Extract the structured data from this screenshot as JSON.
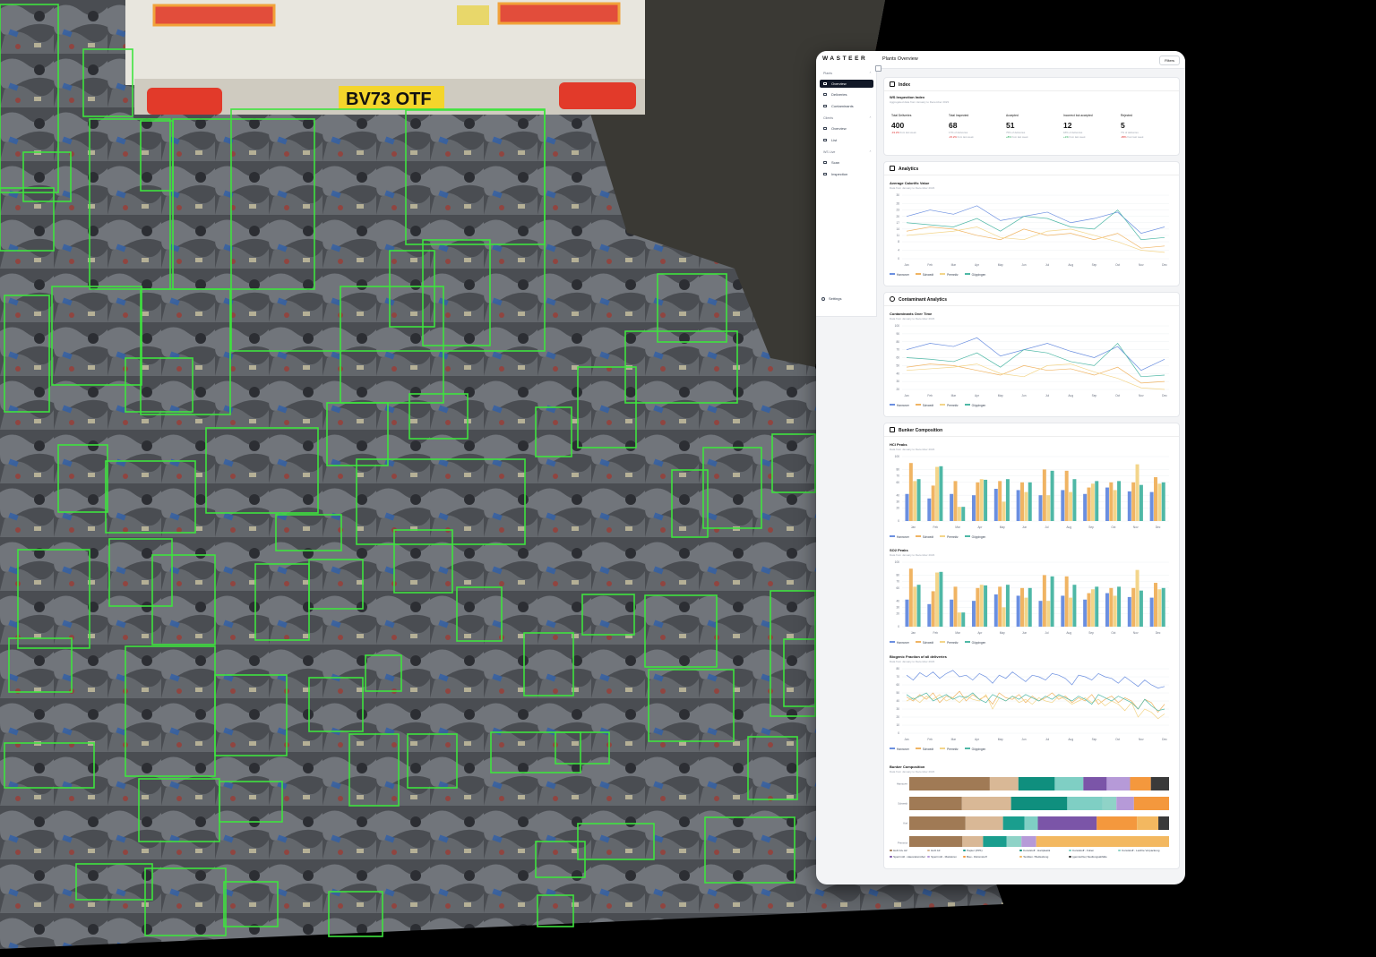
{
  "app": {
    "logo": "WASTEER",
    "page_title": "Plants Overview",
    "filters_label": "Filters"
  },
  "colors": {
    "blue": "#6b8fe0",
    "orange": "#f0b463",
    "yellow": "#f3d58a",
    "teal": "#4fb8a6",
    "detection_box": "#3fe33f"
  },
  "sidebar": {
    "groups": [
      {
        "label": "Plants",
        "items": [
          {
            "label": "Overview",
            "active": true,
            "icon": "grid-icon"
          },
          {
            "label": "Deliveries",
            "icon": "truck-icon"
          },
          {
            "label": "Contaminants",
            "icon": "biohazard-icon"
          }
        ]
      },
      {
        "label": "Clients",
        "items": [
          {
            "label": "Overview",
            "icon": "grid-icon"
          },
          {
            "label": "List",
            "icon": "list-icon"
          }
        ]
      },
      {
        "label": "WS Live",
        "items": [
          {
            "label": "Scan",
            "icon": "scan-icon"
          },
          {
            "label": "Inspection",
            "icon": "eye-icon"
          }
        ]
      }
    ],
    "settings_label": "Settings"
  },
  "index": {
    "title": "Index",
    "subtitle": "WS Inspection Index",
    "description": "Aggregated data from January to December 2023",
    "kpis": [
      {
        "label": "Total Deliveries",
        "value": "400",
        "sub": "",
        "change": "-19.2%",
        "direction": "down",
        "note": "from last week"
      },
      {
        "label": "Total Inspected",
        "value": "68",
        "sub": "17% of deliveries",
        "change": "-15.2%",
        "direction": "down",
        "note": "from last week"
      },
      {
        "label": "Accepted",
        "value": "51",
        "sub": "75% of deliveries",
        "change": "+8%",
        "direction": "up",
        "note": "from last week"
      },
      {
        "label": "Incorrect but accepted",
        "value": "12",
        "sub": "18% of deliveries",
        "change": "+1%",
        "direction": "up",
        "note": "from last week"
      },
      {
        "label": "Rejected",
        "value": "5",
        "sub": "7% of deliveries",
        "change": "-95%",
        "direction": "down",
        "note": "from last week"
      }
    ]
  },
  "analytics": {
    "title": "Analytics",
    "chart_title": "Average Calorific Value",
    "chart_desc": "Data from January to December 2023"
  },
  "contaminant_analytics": {
    "title": "Contaminant Analytics",
    "chart_title": "Contaminants Over Time",
    "chart_desc": "Data from January to December 2023"
  },
  "bunker": {
    "title": "Bunker Composition",
    "hcl_title": "HCl Peaks",
    "hcl_desc": "Data from January to December 2023",
    "so2_title": "SO2 Peaks",
    "so2_desc": "Data from January to December 2023",
    "biogenic_title": "Biogenic Fraction of all deliveries",
    "biogenic_desc": "Data from January to December 2023",
    "composition_title": "Bunker Composition",
    "composition_desc": "Data from January to December 2023"
  },
  "chart_data": [
    {
      "type": "line",
      "title": "Average Calorific Value",
      "categories": [
        "Jan",
        "Feb",
        "Mar",
        "Apr",
        "May",
        "Jun",
        "Jul",
        "Aug",
        "Sep",
        "Oct",
        "Nov",
        "Dec"
      ],
      "yticks": [
        0,
        4,
        8,
        11,
        14,
        17,
        20,
        23,
        26,
        30
      ],
      "ylim": [
        0,
        30
      ],
      "series": [
        {
          "name": "Hannover",
          "color": "#6b8fe0",
          "values": [
            20,
            23,
            21,
            25,
            18,
            20,
            22,
            17,
            19,
            22,
            12,
            15
          ]
        },
        {
          "name": "Schwedt",
          "color": "#f0b463",
          "values": [
            13,
            15,
            14,
            11,
            9,
            14,
            11,
            12,
            9,
            12,
            5,
            6
          ]
        },
        {
          "name": "Premnitz",
          "color": "#f3d58a",
          "values": [
            11,
            12,
            13,
            15,
            10,
            9,
            13,
            14,
            11,
            8,
            4,
            3
          ]
        },
        {
          "name": "Göppingen",
          "color": "#4fb8a6",
          "values": [
            17,
            16,
            15,
            19,
            13,
            20,
            19,
            15,
            14,
            23,
            9,
            10
          ]
        }
      ]
    },
    {
      "type": "line",
      "title": "Contaminants Over Time",
      "categories": [
        "Jan",
        "Feb",
        "Mar",
        "Apr",
        "May",
        "Jun",
        "Jul",
        "Aug",
        "Sep",
        "Oct",
        "Nov",
        "Dec"
      ],
      "yticks": [
        20,
        30,
        40,
        50,
        60,
        70,
        80,
        90,
        100
      ],
      "ylim": [
        20,
        100
      ],
      "series": [
        {
          "name": "Hannover",
          "color": "#6b8fe0",
          "values": [
            70,
            78,
            74,
            85,
            62,
            70,
            78,
            68,
            60,
            74,
            44,
            58
          ]
        },
        {
          "name": "Schwedt",
          "color": "#f0b463",
          "values": [
            48,
            52,
            50,
            44,
            38,
            50,
            44,
            46,
            38,
            48,
            28,
            30
          ]
        },
        {
          "name": "Premnitz",
          "color": "#f3d58a",
          "values": [
            44,
            46,
            48,
            52,
            40,
            36,
            50,
            52,
            42,
            34,
            22,
            20
          ]
        },
        {
          "name": "Göppingen",
          "color": "#4fb8a6",
          "values": [
            60,
            58,
            55,
            66,
            48,
            70,
            66,
            55,
            50,
            78,
            36,
            38
          ]
        }
      ]
    },
    {
      "type": "bar",
      "title": "HCl Peaks",
      "categories": [
        "Jan",
        "Feb",
        "Mar",
        "Apr",
        "May",
        "Jun",
        "Jul",
        "Aug",
        "Sep",
        "Oct",
        "Nov",
        "Dec"
      ],
      "yticks": [
        0,
        20,
        30,
        40,
        60,
        70,
        80,
        100
      ],
      "ylim": [
        0,
        100
      ],
      "series": [
        {
          "name": "Hannover",
          "color": "#6b8fe0",
          "values": [
            42,
            35,
            42,
            40,
            50,
            48,
            40,
            48,
            42,
            52,
            46,
            45
          ]
        },
        {
          "name": "Schwedt",
          "color": "#f0b463",
          "values": [
            90,
            55,
            62,
            60,
            62,
            60,
            80,
            78,
            52,
            60,
            60,
            68
          ]
        },
        {
          "name": "Premnitz",
          "color": "#f3d58a",
          "values": [
            62,
            84,
            22,
            65,
            30,
            45,
            40,
            45,
            58,
            48,
            88,
            58
          ]
        },
        {
          "name": "Göppingen",
          "color": "#4fb8a6",
          "values": [
            65,
            85,
            22,
            64,
            65,
            60,
            78,
            65,
            62,
            62,
            56,
            60
          ]
        }
      ]
    },
    {
      "type": "bar",
      "title": "SO2 Peaks",
      "categories": [
        "Jan",
        "Feb",
        "Mar",
        "Apr",
        "May",
        "Jun",
        "Jul",
        "Aug",
        "Sep",
        "Oct",
        "Nov",
        "Dec"
      ],
      "yticks": [
        0,
        20,
        30,
        40,
        60,
        70,
        80,
        100
      ],
      "ylim": [
        0,
        100
      ],
      "series": [
        {
          "name": "Hannover",
          "color": "#6b8fe0",
          "values": [
            42,
            35,
            42,
            40,
            50,
            48,
            40,
            48,
            42,
            52,
            46,
            45
          ]
        },
        {
          "name": "Schwedt",
          "color": "#f0b463",
          "values": [
            90,
            55,
            62,
            60,
            62,
            60,
            80,
            78,
            52,
            60,
            60,
            68
          ]
        },
        {
          "name": "Premnitz",
          "color": "#f3d58a",
          "values": [
            62,
            84,
            22,
            65,
            30,
            45,
            40,
            45,
            58,
            48,
            88,
            58
          ]
        },
        {
          "name": "Göppingen",
          "color": "#4fb8a6",
          "values": [
            65,
            85,
            22,
            64,
            65,
            60,
            78,
            65,
            62,
            62,
            56,
            60
          ]
        }
      ]
    },
    {
      "type": "line",
      "title": "Biogenic Fraction of all deliveries",
      "categories": [
        "Jan",
        "Feb",
        "Mar",
        "Apr",
        "May",
        "Jun",
        "Jul",
        "Aug",
        "Sep",
        "Oct",
        "Nov",
        "Dec"
      ],
      "yticks": [
        0,
        10,
        20,
        30,
        40,
        50,
        60,
        70,
        80
      ],
      "ylim": [
        0,
        80
      ],
      "series": [
        {
          "name": "Hannover",
          "color": "#6b8fe0",
          "values": [
            72,
            66,
            75,
            70,
            76,
            68,
            74,
            78,
            70,
            72,
            66,
            74,
            70,
            62,
            72,
            68,
            76,
            70,
            64,
            72,
            70,
            66,
            74,
            72,
            68,
            60,
            72,
            70,
            66,
            74,
            70,
            68,
            62,
            70,
            64,
            58,
            66,
            60,
            56,
            58
          ]
        },
        {
          "name": "Schwedt",
          "color": "#f0b463",
          "values": [
            45,
            40,
            48,
            42,
            50,
            38,
            46,
            44,
            52,
            40,
            48,
            42,
            46,
            36,
            50,
            44,
            42,
            48,
            38,
            46,
            40,
            44,
            50,
            42,
            46,
            38,
            44,
            40,
            48,
            36,
            42,
            46,
            38,
            44,
            40,
            30,
            42,
            38,
            26,
            36
          ]
        },
        {
          "name": "Premnitz",
          "color": "#f3d58a",
          "values": [
            40,
            44,
            38,
            46,
            42,
            48,
            40,
            44,
            38,
            46,
            42,
            40,
            48,
            30,
            44,
            40,
            46,
            38,
            42,
            36,
            44,
            40,
            38,
            46,
            42,
            36,
            40,
            44,
            38,
            42,
            34,
            40,
            36,
            28,
            38,
            20,
            30,
            26,
            18,
            24
          ]
        },
        {
          "name": "Göppingen",
          "color": "#4fb8a6",
          "values": [
            48,
            42,
            46,
            50,
            40,
            44,
            48,
            42,
            46,
            44,
            50,
            42,
            38,
            48,
            44,
            40,
            46,
            42,
            48,
            44,
            40,
            46,
            42,
            48,
            44,
            40,
            46,
            42,
            36,
            48,
            44,
            40,
            46,
            42,
            38,
            30,
            42,
            34,
            28,
            30
          ]
        }
      ]
    },
    {
      "type": "bar",
      "stacked": true,
      "orientation": "horizontal",
      "title": "Bunker Composition",
      "categories": [
        "Hannover",
        "Schwedt",
        "Kiel",
        "Premnitz"
      ],
      "series": [
        {
          "name": "Holz AI+ A2",
          "color": "#a07a55",
          "values": [
            31,
            15,
            21,
            18
          ]
        },
        {
          "name": "Holz A3",
          "color": "#d9b896",
          "values": [
            11,
            14,
            14,
            7
          ]
        },
        {
          "name": "Papier (PPK)",
          "color": "#1a9e8e",
          "values": [
            0,
            0,
            8,
            8
          ]
        },
        {
          "name": "Kunststoff - Hartplastik",
          "color": "#0f8f7e",
          "values": [
            14,
            16,
            0,
            0
          ]
        },
        {
          "name": "Kunststoff - Folien",
          "color": "#7fcfc4",
          "values": [
            11,
            10,
            5,
            0
          ]
        },
        {
          "name": "Kunststoff - Leichte Verpackung",
          "color": "#8fd3c7",
          "values": [
            0,
            4,
            0,
            5
          ]
        },
        {
          "name": "Sperrmüll - Hausratsmöbel",
          "color": "#7b55a8",
          "values": [
            9,
            0,
            22,
            0
          ]
        },
        {
          "name": "Sperrmüll - Matratzen",
          "color": "#b69ad8",
          "values": [
            9,
            5,
            0,
            5
          ]
        },
        {
          "name": "Bau - Dämmstoff",
          "color": "#f4983d",
          "values": [
            8,
            10,
            15,
            0
          ]
        },
        {
          "name": "Textilien / Bekleidung",
          "color": "#f3b860",
          "values": [
            0,
            0,
            8,
            45
          ]
        },
        {
          "name": "(gemischte) Siedlungsabfälle",
          "color": "#3a3a3a",
          "values": [
            7,
            0,
            4,
            0
          ]
        }
      ]
    }
  ]
}
